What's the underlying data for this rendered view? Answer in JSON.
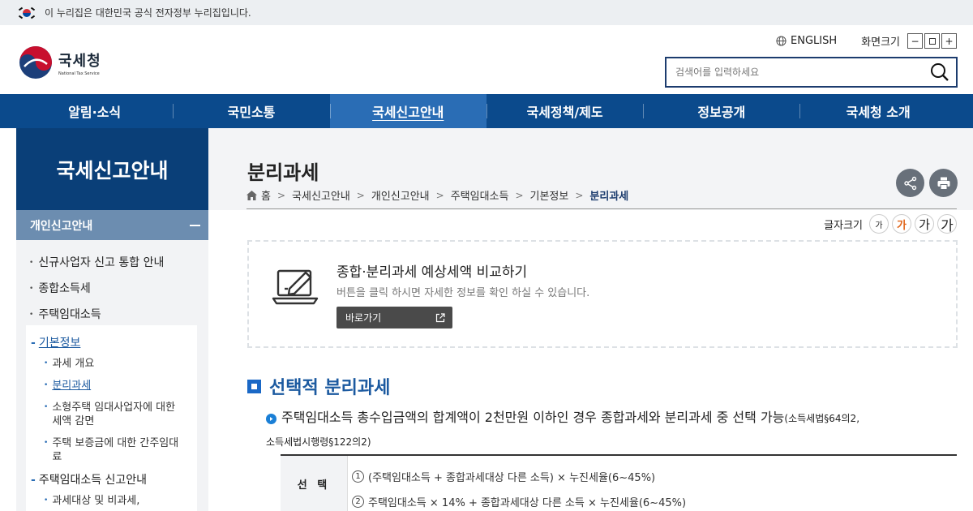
{
  "gov_banner": {
    "text": "이 누리집은 대한민국 공식 전자정부 누리집입니다."
  },
  "logo": {
    "name": "국세청",
    "name_en": "National Tax Service"
  },
  "util": {
    "english": "ENGLISH",
    "zoom_label": "화면크기",
    "zoom_out": "−",
    "zoom_reset": "",
    "zoom_in": "+"
  },
  "search": {
    "placeholder": "검색어를 입력하세요"
  },
  "gnb": [
    "알림·소식",
    "국민소통",
    "국세신고안내",
    "국세정책/제도",
    "정보공개",
    "국세청 소개"
  ],
  "gnb_active": "국세신고안내",
  "lnb": {
    "title": "국세신고안내",
    "group": "개인신고안내",
    "d1": [
      "신규사업자 신고 통합 안내",
      "종합소득세",
      "주택임대소득"
    ],
    "d2_basic": "기본정보",
    "d3": [
      "과세 개요",
      "분리과세",
      "소형주택 임대사업자에 대한 세액 감면",
      "주택 보증금에 대한 간주임대료"
    ],
    "d2_report": "주택임대소득 신고안내",
    "d3_more": "과세대상 및 비과세,"
  },
  "page": {
    "title": "분리과세",
    "breadcrumb": [
      "홈",
      "국세신고안내",
      "개인신고안내",
      "주택임대소득",
      "기본정보",
      "분리과세"
    ]
  },
  "font_size": {
    "label": "글자크기",
    "buttons": [
      "가",
      "가",
      "가",
      "가"
    ]
  },
  "promo": {
    "title": "종합·분리과세 예상세액 비교하기",
    "desc": "버튼을 클릭 하시면 자세한 정보를 확인 하실 수 있습니다.",
    "button": "바로가기"
  },
  "section": {
    "title": "선택적 분리과세",
    "bullet": "주택임대소득 총수입금액의 합계액이 2천만원 이하인 경우 종합과세와 분리과세 중 선택 가능",
    "bullet_ref1": "(소득세법§64의2,",
    "bullet_ref2": "소득세법시행령§122의2)"
  },
  "table": {
    "header": "선 택",
    "options": [
      {
        "num": "1",
        "text": "(주택임대소득 + 종합과세대상 다른 소득) × 누진세율(6~45%)"
      },
      {
        "num": "2",
        "text": "주택임대소득 × 14% + 종합과세대상 다른 소득 × 누진세율(6~45%)"
      }
    ]
  },
  "colors": {
    "nav": "#0b4a8c",
    "nav_active": "#2a6db5",
    "lnb_head": "#0a3f78",
    "accent": "#1a68c6"
  }
}
